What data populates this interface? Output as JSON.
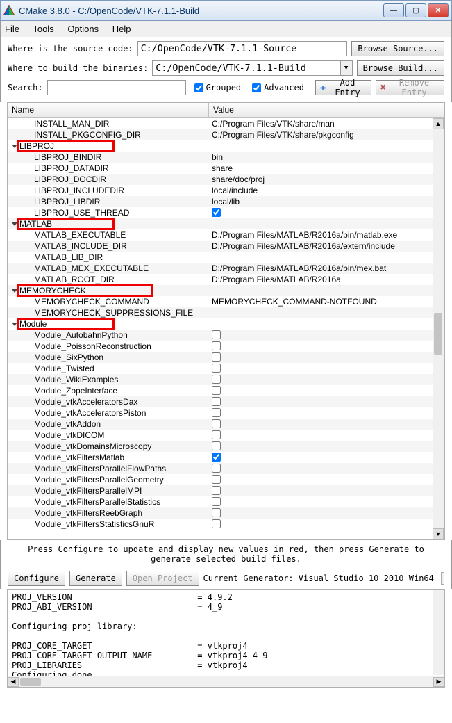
{
  "title": "CMake 3.8.0 - C:/OpenCode/VTK-7.1.1-Build",
  "menu": {
    "file": "File",
    "tools": "Tools",
    "options": "Options",
    "help": "Help"
  },
  "src": {
    "label": "Where is the source code:",
    "value": "C:/OpenCode/VTK-7.1.1-Source",
    "btn": "Browse Source..."
  },
  "bld": {
    "label": "Where to build the binaries:",
    "value": "C:/OpenCode/VTK-7.1.1-Build",
    "btn": "Browse Build..."
  },
  "search_label": "Search:",
  "grouped": "Grouped",
  "advanced": "Advanced",
  "add_entry": "Add Entry",
  "remove_entry": "Remove Entry",
  "cols": {
    "name": "Name",
    "value": "Value"
  },
  "rows": [
    {
      "t": "item",
      "n": "INSTALL_MAN_DIR",
      "v": "C:/Program Files/VTK/share/man"
    },
    {
      "t": "item",
      "n": "INSTALL_PKGCONFIG_DIR",
      "v": "C:/Program Files/VTK/share/pkgconfig"
    },
    {
      "t": "group",
      "n": "LIBPROJ"
    },
    {
      "t": "item",
      "n": "LIBPROJ_BINDIR",
      "v": "bin"
    },
    {
      "t": "item",
      "n": "LIBPROJ_DATADIR",
      "v": "share"
    },
    {
      "t": "item",
      "n": "LIBPROJ_DOCDIR",
      "v": "share/doc/proj"
    },
    {
      "t": "item",
      "n": "LIBPROJ_INCLUDEDIR",
      "v": "local/include"
    },
    {
      "t": "item",
      "n": "LIBPROJ_LIBDIR",
      "v": "local/lib"
    },
    {
      "t": "item",
      "n": "LIBPROJ_USE_THREAD",
      "cb": true,
      "chk": true
    },
    {
      "t": "group",
      "n": "MATLAB"
    },
    {
      "t": "item",
      "n": "MATLAB_EXECUTABLE",
      "v": "D:/Program Files/MATLAB/R2016a/bin/matlab.exe"
    },
    {
      "t": "item",
      "n": "MATLAB_INCLUDE_DIR",
      "v": "D:/Program Files/MATLAB/R2016a/extern/include"
    },
    {
      "t": "item",
      "n": "MATLAB_LIB_DIR",
      "v": ""
    },
    {
      "t": "item",
      "n": "MATLAB_MEX_EXECUTABLE",
      "v": "D:/Program Files/MATLAB/R2016a/bin/mex.bat"
    },
    {
      "t": "item",
      "n": "MATLAB_ROOT_DIR",
      "v": "D:/Program Files/MATLAB/R2016a"
    },
    {
      "t": "group",
      "n": "MEMORYCHECK"
    },
    {
      "t": "item",
      "n": "MEMORYCHECK_COMMAND",
      "v": "MEMORYCHECK_COMMAND-NOTFOUND"
    },
    {
      "t": "item",
      "n": "MEMORYCHECK_SUPPRESSIONS_FILE",
      "v": ""
    },
    {
      "t": "group",
      "n": "Module"
    },
    {
      "t": "item",
      "n": "Module_AutobahnPython",
      "cb": true
    },
    {
      "t": "item",
      "n": "Module_PoissonReconstruction",
      "cb": true
    },
    {
      "t": "item",
      "n": "Module_SixPython",
      "cb": true
    },
    {
      "t": "item",
      "n": "Module_Twisted",
      "cb": true
    },
    {
      "t": "item",
      "n": "Module_WikiExamples",
      "cb": true
    },
    {
      "t": "item",
      "n": "Module_ZopeInterface",
      "cb": true
    },
    {
      "t": "item",
      "n": "Module_vtkAcceleratorsDax",
      "cb": true
    },
    {
      "t": "item",
      "n": "Module_vtkAcceleratorsPiston",
      "cb": true
    },
    {
      "t": "item",
      "n": "Module_vtkAddon",
      "cb": true
    },
    {
      "t": "item",
      "n": "Module_vtkDICOM",
      "cb": true
    },
    {
      "t": "item",
      "n": "Module_vtkDomainsMicroscopy",
      "cb": true
    },
    {
      "t": "item",
      "n": "Module_vtkFiltersMatlab",
      "cb": true,
      "chk": true
    },
    {
      "t": "item",
      "n": "Module_vtkFiltersParallelFlowPaths",
      "cb": true
    },
    {
      "t": "item",
      "n": "Module_vtkFiltersParallelGeometry",
      "cb": true
    },
    {
      "t": "item",
      "n": "Module_vtkFiltersParallelMPI",
      "cb": true
    },
    {
      "t": "item",
      "n": "Module_vtkFiltersParallelStatistics",
      "cb": true
    },
    {
      "t": "item",
      "n": "Module_vtkFiltersReebGraph",
      "cb": true
    },
    {
      "t": "item",
      "n": "Module_vtkFiltersStatisticsGnuR",
      "cb": true
    }
  ],
  "hint": "Press Configure to update and display new values in red, then press Generate to generate selected build files.",
  "configure": "Configure",
  "generate": "Generate",
  "open_project": "Open Project",
  "generator_label": "Current Generator: Visual Studio 10 2010 Win64",
  "log": "PROJ_VERSION                         = 4.9.2\nPROJ_ABI_VERSION                     = 4_9\n\nConfiguring proj library:\n\nPROJ_CORE_TARGET                     = vtkproj4\nPROJ_CORE_TARGET_OUTPUT_NAME         = vtkproj4_4_9\nPROJ_LIBRARIES                       = vtkproj4\nConfiguring done"
}
